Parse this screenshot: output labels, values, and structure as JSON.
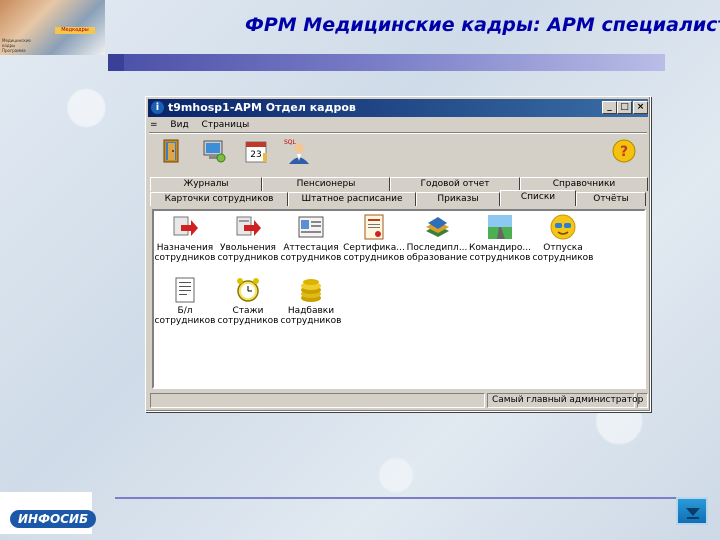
{
  "slide": {
    "title": "ФРМ Медицинские кадры: АРМ специалиста",
    "logo_text": "ИНФОСИБ",
    "photo_mini_lines": [
      "Медицинские",
      "кадры",
      "Программа"
    ],
    "photo_logo_text": "Медкадры"
  },
  "window": {
    "icon": "i",
    "title": "t9mhosp1-АРМ Отдел кадров",
    "controls": [
      "_",
      "□",
      "×"
    ],
    "menu": [
      "=",
      "Вид",
      "Страницы"
    ],
    "toolbar": [
      "exit-door-icon",
      "computer-icon",
      "calendar-icon",
      "sql-user-icon",
      "help-icon"
    ],
    "calendar_day": "23",
    "sql_label": "SQL"
  },
  "tabs_top": [
    "Журналы",
    "Пенсионеры",
    "Годовой отчет",
    "Справочники"
  ],
  "tabs_bottom": [
    "Карточки сотрудников",
    "Штатное расписание",
    "Приказы",
    "Списки",
    "Отчёты"
  ],
  "active_tab": "Списки",
  "items_row1": [
    {
      "line1": "Назначения",
      "line2": "сотрудников",
      "icon": "assign-arrow-icon"
    },
    {
      "line1": "Увольнения",
      "line2": "сотрудников",
      "icon": "dismiss-arrow-icon"
    },
    {
      "line1": "Аттестация",
      "line2": "сотрудников",
      "icon": "attestation-icon"
    },
    {
      "line1": "Сертифика...",
      "line2": "сотрудников",
      "icon": "certificate-icon"
    },
    {
      "line1": "Последипл...",
      "line2": "образование",
      "icon": "books-icon"
    },
    {
      "line1": "Командиро...",
      "line2": "сотрудников",
      "icon": "road-icon"
    },
    {
      "line1": "Отпуска",
      "line2": "сотрудников",
      "icon": "sun-glasses-icon"
    }
  ],
  "items_row2": [
    {
      "line1": "Б/л",
      "line2": "сотрудников",
      "icon": "sick-list-icon"
    },
    {
      "line1": "Стажи",
      "line2": "сотрудников",
      "icon": "alarm-clock-icon"
    },
    {
      "line1": "Надбавки",
      "line2": "сотрудников",
      "icon": "coins-icon"
    }
  ],
  "status": [
    "",
    "Самый главный администратор",
    ""
  ]
}
